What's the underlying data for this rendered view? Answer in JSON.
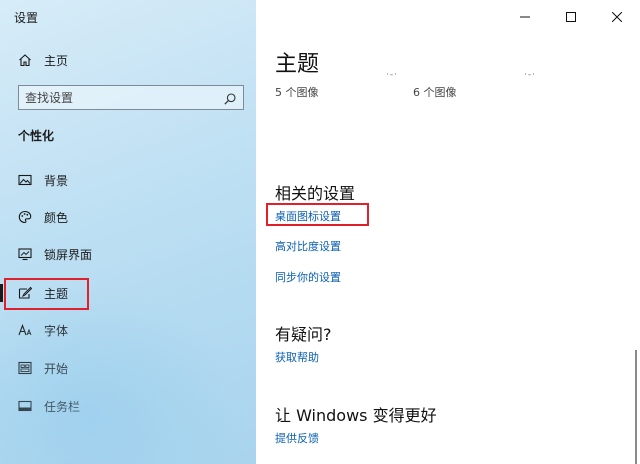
{
  "window": {
    "title": "设置",
    "minimize_icon": "minimize-icon",
    "maximize_icon": "maximize-icon",
    "close_icon": "close-icon"
  },
  "sidebar": {
    "home_label": "主页",
    "search": {
      "placeholder": "查找设置"
    },
    "section": "个性化",
    "items": [
      {
        "label": "背景",
        "icon": "picture-icon"
      },
      {
        "label": "颜色",
        "icon": "palette-icon"
      },
      {
        "label": "锁屏界面",
        "icon": "lock-screen-icon"
      },
      {
        "label": "主题",
        "icon": "theme-brush-icon",
        "selected": true
      },
      {
        "label": "字体",
        "icon": "font-icon"
      },
      {
        "label": "开始",
        "icon": "start-icon"
      },
      {
        "label": "任务栏",
        "icon": "taskbar-icon"
      }
    ]
  },
  "main": {
    "title": "主题",
    "themes": [
      {
        "count_label": "5 个图像"
      },
      {
        "count_label": "6 个图像"
      }
    ],
    "related": {
      "heading": "相关的设置",
      "links": [
        "桌面图标设置",
        "高对比度设置",
        "同步你的设置"
      ]
    },
    "questions": {
      "heading": "有疑问?",
      "link": "获取帮助"
    },
    "feedback": {
      "heading": "让 Windows 变得更好",
      "link": "提供反馈"
    }
  },
  "colors": {
    "accent_link": "#0a5fb4",
    "highlight_box": "#e0202a"
  }
}
